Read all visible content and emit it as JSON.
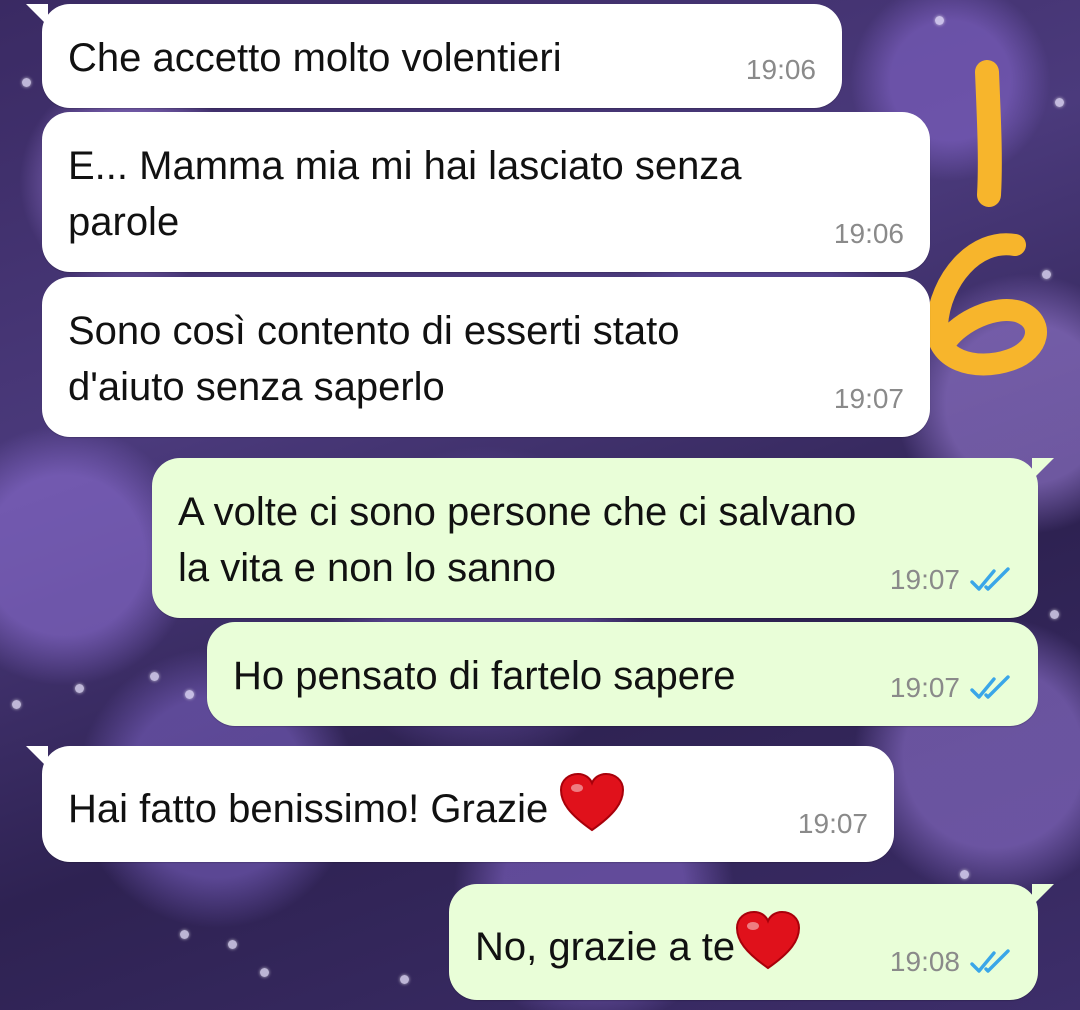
{
  "colors": {
    "incoming_bubble": "#ffffff",
    "outgoing_bubble": "#e9fed8",
    "read_ticks": "#3aa6e8",
    "annotation": "#f7b52c"
  },
  "annotation": {
    "text": "16",
    "icon": "handwritten-number-annotation"
  },
  "messages": [
    {
      "direction": "incoming",
      "lines": [
        "Che accetto molto volentieri"
      ],
      "time": "19:06"
    },
    {
      "direction": "incoming",
      "lines": [
        "E... Mamma mia mi hai lasciato senza",
        "parole"
      ],
      "time": "19:06"
    },
    {
      "direction": "incoming",
      "lines": [
        "Sono così contento di esserti stato",
        "d'aiuto senza saperlo"
      ],
      "time": "19:07"
    },
    {
      "direction": "outgoing",
      "lines": [
        "A volte ci sono persone che ci salvano",
        "la vita e non lo sanno"
      ],
      "time": "19:07",
      "status": "read",
      "status_icon": "double-check-icon"
    },
    {
      "direction": "outgoing",
      "lines": [
        "Ho pensato di fartelo sapere"
      ],
      "time": "19:07",
      "status": "read",
      "status_icon": "double-check-icon"
    },
    {
      "direction": "incoming",
      "lines": [
        "Hai fatto benissimo! Grazie"
      ],
      "time": "19:07",
      "emoji": "red-heart-icon"
    },
    {
      "direction": "outgoing",
      "lines": [
        "No, grazie a te"
      ],
      "time": "19:08",
      "status": "read",
      "status_icon": "double-check-icon",
      "emoji": "red-heart-icon"
    }
  ]
}
